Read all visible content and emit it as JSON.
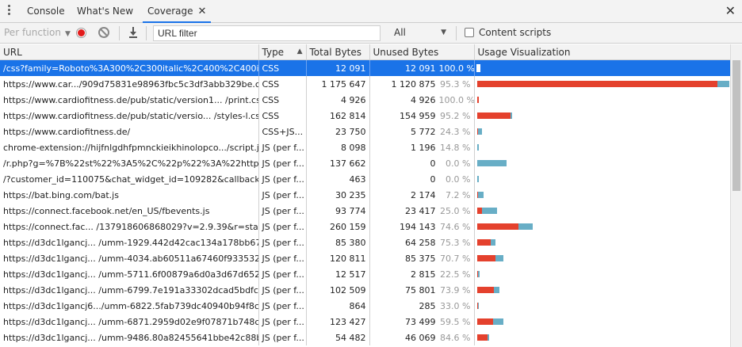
{
  "tabs": [
    {
      "label": "Console"
    },
    {
      "label": "What's New"
    },
    {
      "label": "Coverage"
    }
  ],
  "toolbar": {
    "per_function": "Per function",
    "url_filter_placeholder": "URL filter",
    "type_filter": "All",
    "content_scripts": "Content scripts"
  },
  "columns": {
    "url": "URL",
    "type": "Type",
    "total": "Total Bytes",
    "unused": "Unused Bytes",
    "vis": "Usage Visualization"
  },
  "colors": {
    "used": "#68aec6",
    "unused": "#e4412d",
    "selected": "#1a73e8"
  },
  "rows": [
    {
      "url": "/css?family=Roboto%3A300%2C300italic%2C400%2C400ital",
      "type": "CSS",
      "total": "12 091",
      "unused": "12 091",
      "pct": "100.0 %",
      "total_n": 12091,
      "unused_frac": 1.0
    },
    {
      "url": "https://www.car.../909d75831e98963fbc5c3df3abb329be.css",
      "type": "CSS",
      "total": "1 175 647",
      "unused": "1 120 875",
      "pct": "95.3 %",
      "total_n": 1175647,
      "unused_frac": 0.953
    },
    {
      "url": "https://www.cardiofitness.de/pub/static/version1... /print.css",
      "type": "CSS",
      "total": "4 926",
      "unused": "4 926",
      "pct": "100.0 %",
      "total_n": 4926,
      "unused_frac": 1.0
    },
    {
      "url": "https://www.cardiofitness.de/pub/static/versio... /styles-l.css",
      "type": "CSS",
      "total": "162 814",
      "unused": "154 959",
      "pct": "95.2 %",
      "total_n": 162814,
      "unused_frac": 0.952
    },
    {
      "url": "https://www.cardiofitness.de/",
      "type": "CSS+JS...",
      "total": "23 750",
      "unused": "5 772",
      "pct": "24.3 %",
      "total_n": 23750,
      "unused_frac": 0.243
    },
    {
      "url": "chrome-extension://hijfnlgdhfpmnckieikhinolopco.../script.js",
      "type": "JS (per f...",
      "total": "8 098",
      "unused": "1 196",
      "pct": "14.8 %",
      "total_n": 8098,
      "unused_frac": 0.148
    },
    {
      "url": "/r.php?g=%7B%22st%22%3A5%2C%22p%22%3A%22https%",
      "type": "JS (per f...",
      "total": "137 662",
      "unused": "0",
      "pct": "0.0 %",
      "total_n": 137662,
      "unused_frac": 0.0
    },
    {
      "url": "/?customer_id=110075&chat_widget_id=109282&callback=_",
      "type": "JS (per f...",
      "total": "463",
      "unused": "0",
      "pct": "0.0 %",
      "total_n": 463,
      "unused_frac": 0.0
    },
    {
      "url": "https://bat.bing.com/bat.js",
      "type": "JS (per f...",
      "total": "30 235",
      "unused": "2 174",
      "pct": "7.2 %",
      "total_n": 30235,
      "unused_frac": 0.072
    },
    {
      "url": "https://connect.facebook.net/en_US/fbevents.js",
      "type": "JS (per f...",
      "total": "93 774",
      "unused": "23 417",
      "pct": "25.0 %",
      "total_n": 93774,
      "unused_frac": 0.25
    },
    {
      "url": "https://connect.fac... /137918606868029?v=2.9.39&r=stable",
      "type": "JS (per f...",
      "total": "260 159",
      "unused": "194 143",
      "pct": "74.6 %",
      "total_n": 260159,
      "unused_frac": 0.746
    },
    {
      "url": "https://d3dc1lgancj... /umm-1929.442d42cac134a178bb67.js",
      "type": "JS (per f...",
      "total": "85 380",
      "unused": "64 258",
      "pct": "75.3 %",
      "total_n": 85380,
      "unused_frac": 0.753
    },
    {
      "url": "https://d3dc1lgancj... /umm-4034.ab60511a67460f933532.js",
      "type": "JS (per f...",
      "total": "120 811",
      "unused": "85 375",
      "pct": "70.7 %",
      "total_n": 120811,
      "unused_frac": 0.707
    },
    {
      "url": "https://d3dc1lgancj... /umm-5711.6f00879a6d0a3d67d652.js",
      "type": "JS (per f...",
      "total": "12 517",
      "unused": "2 815",
      "pct": "22.5 %",
      "total_n": 12517,
      "unused_frac": 0.225
    },
    {
      "url": "https://d3dc1lgancj... /umm-6799.7e191a33302dcad5bdfc.js",
      "type": "JS (per f...",
      "total": "102 509",
      "unused": "75 801",
      "pct": "73.9 %",
      "total_n": 102509,
      "unused_frac": 0.739
    },
    {
      "url": "https://d3dc1lgancj6.../umm-6822.5fab739dc40940b94f8c.js",
      "type": "JS (per f...",
      "total": "864",
      "unused": "285",
      "pct": "33.0 %",
      "total_n": 864,
      "unused_frac": 0.33
    },
    {
      "url": "https://d3dc1lgancj... /umm-6871.2959d02e9f07871b748c.js",
      "type": "JS (per f...",
      "total": "123 427",
      "unused": "73 499",
      "pct": "59.5 %",
      "total_n": 123427,
      "unused_frac": 0.595
    },
    {
      "url": "https://d3dc1lgancj... /umm-9486.80a82455641bbe42c88b.js",
      "type": "JS (per f...",
      "total": "54 482",
      "unused": "46 069",
      "pct": "84.6 %",
      "total_n": 54482,
      "unused_frac": 0.846
    }
  ]
}
